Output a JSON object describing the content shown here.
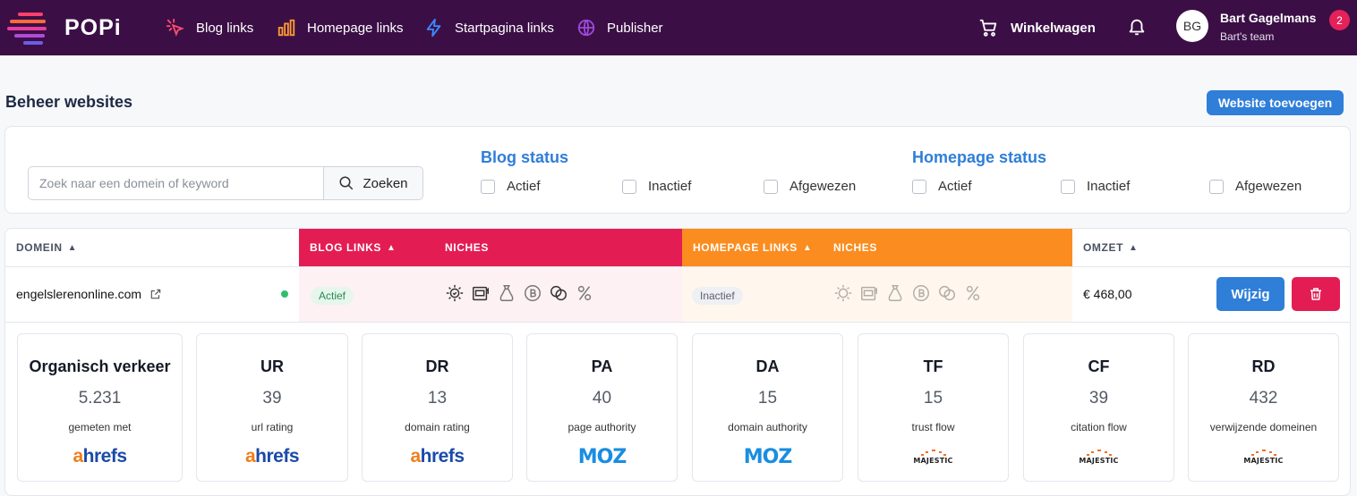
{
  "brand": {
    "name": "POPi"
  },
  "nav": {
    "items": [
      {
        "label": "Blog links",
        "icon": "cursor-click-icon"
      },
      {
        "label": "Homepage links",
        "icon": "bar-chart-icon"
      },
      {
        "label": "Startpagina links",
        "icon": "lightning-icon"
      },
      {
        "label": "Publisher",
        "icon": "globe-icon"
      }
    ],
    "cart_label": "Winkelwagen"
  },
  "user": {
    "initials": "BG",
    "name": "Bart Gagelmans",
    "team": "Bart's team",
    "notifications": "2"
  },
  "page": {
    "title": "Beheer websites",
    "add_button": "Website toevoegen"
  },
  "filters": {
    "search_placeholder": "Zoek naar een domein of keyword",
    "search_button": "Zoeken",
    "blog_status": {
      "title": "Blog status",
      "options": [
        "Actief",
        "Inactief",
        "Afgewezen"
      ]
    },
    "homepage_status": {
      "title": "Homepage status",
      "options": [
        "Actief",
        "Inactief",
        "Afgewezen"
      ]
    }
  },
  "table": {
    "headers": {
      "domain": "DOMEIN",
      "blog_links": "BLOG LINKS",
      "niches": "NICHES",
      "homepage_links": "HOMEPAGE LINKS",
      "niches2": "NICHES",
      "omzet": "OMZET"
    },
    "row": {
      "domain": "engelslerenonline.com",
      "blog_status": "Actief",
      "homepage_status": "Inactief",
      "omzet": "€ 468,00",
      "edit_label": "Wijzig"
    }
  },
  "metrics": [
    {
      "title": "Organisch verkeer",
      "value": "5.231",
      "sub": "gemeten met",
      "logo": "ahrefs"
    },
    {
      "title": "UR",
      "value": "39",
      "sub": "url rating",
      "logo": "ahrefs"
    },
    {
      "title": "DR",
      "value": "13",
      "sub": "domain rating",
      "logo": "ahrefs"
    },
    {
      "title": "PA",
      "value": "40",
      "sub": "page authority",
      "logo": "moz"
    },
    {
      "title": "DA",
      "value": "15",
      "sub": "domain authority",
      "logo": "moz"
    },
    {
      "title": "TF",
      "value": "15",
      "sub": "trust flow",
      "logo": "majestic"
    },
    {
      "title": "CF",
      "value": "39",
      "sub": "citation flow",
      "logo": "majestic"
    },
    {
      "title": "RD",
      "value": "432",
      "sub": "verwijzende domeinen",
      "logo": "majestic"
    }
  ],
  "logos": {
    "ahrefs_a": "a",
    "ahrefs_rest": "hrefs",
    "moz": "MOZ",
    "majestic": "MAJESTIC"
  },
  "colors": {
    "nav_bg": "#3b0f46",
    "blog": "#e31d54",
    "homepage": "#fb8c1f",
    "primary": "#2f7ed8"
  }
}
